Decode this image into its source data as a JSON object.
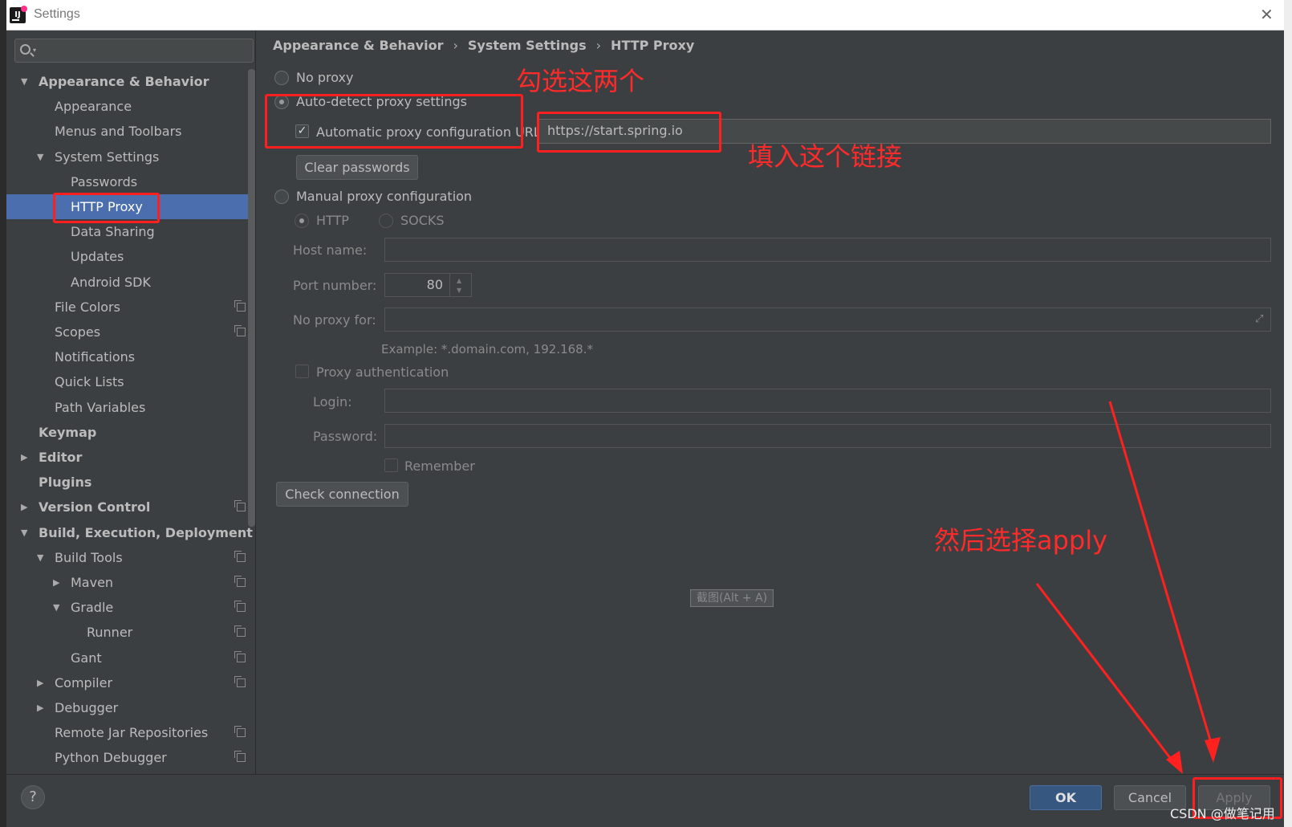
{
  "window": {
    "title": "Settings",
    "close_glyph": "✕"
  },
  "search": {
    "placeholder": ""
  },
  "tree": [
    {
      "label": "Appearance & Behavior",
      "level": 0,
      "arrow": "▼",
      "bold": true
    },
    {
      "label": "Appearance",
      "level": 1
    },
    {
      "label": "Menus and Toolbars",
      "level": 1
    },
    {
      "label": "System Settings",
      "level": 1,
      "arrow": "▼"
    },
    {
      "label": "Passwords",
      "level": 2
    },
    {
      "label": "HTTP Proxy",
      "level": 2,
      "selected": true
    },
    {
      "label": "Data Sharing",
      "level": 2
    },
    {
      "label": "Updates",
      "level": 2
    },
    {
      "label": "Android SDK",
      "level": 2
    },
    {
      "label": "File Colors",
      "level": 1,
      "copy": true
    },
    {
      "label": "Scopes",
      "level": 1,
      "copy": true
    },
    {
      "label": "Notifications",
      "level": 1
    },
    {
      "label": "Quick Lists",
      "level": 1
    },
    {
      "label": "Path Variables",
      "level": 1
    },
    {
      "label": "Keymap",
      "level": 0,
      "bold": true
    },
    {
      "label": "Editor",
      "level": 0,
      "arrow": "▶",
      "bold": true
    },
    {
      "label": "Plugins",
      "level": 0,
      "bold": true
    },
    {
      "label": "Version Control",
      "level": 0,
      "arrow": "▶",
      "bold": true,
      "copy": true
    },
    {
      "label": "Build, Execution, Deployment",
      "level": 0,
      "arrow": "▼",
      "bold": true
    },
    {
      "label": "Build Tools",
      "level": 1,
      "arrow": "▼",
      "copy": true
    },
    {
      "label": "Maven",
      "level": 2,
      "arrow": "▶",
      "copy": true
    },
    {
      "label": "Gradle",
      "level": 2,
      "arrow": "▼",
      "copy": true
    },
    {
      "label": "Runner",
      "level": 3,
      "copy": true
    },
    {
      "label": "Gant",
      "level": 2,
      "copy": true
    },
    {
      "label": "Compiler",
      "level": 1,
      "arrow": "▶",
      "copy": true
    },
    {
      "label": "Debugger",
      "level": 1,
      "arrow": "▶"
    },
    {
      "label": "Remote Jar Repositories",
      "level": 1,
      "copy": true
    },
    {
      "label": "Python Debugger",
      "level": 1,
      "copy": true
    }
  ],
  "breadcrumb": {
    "items": [
      "Appearance & Behavior",
      "System Settings",
      "HTTP Proxy"
    ],
    "separator": "›"
  },
  "proxy": {
    "no_proxy": "No proxy",
    "auto_detect": "Auto-detect proxy settings",
    "auto_config_url_label": "Automatic proxy configuration URL:",
    "auto_config_url_value": "https://start.spring.io",
    "clear_passwords": "Clear passwords",
    "manual": "Manual proxy configuration",
    "http": "HTTP",
    "socks": "SOCKS",
    "host_label": "Host name:",
    "port_label": "Port number:",
    "port_value": "80",
    "no_proxy_for_label": "No proxy for:",
    "example": "Example: *.domain.com, 192.168.*",
    "proxy_auth": "Proxy authentication",
    "login_label": "Login:",
    "password_label": "Password:",
    "remember": "Remember",
    "check_connection": "Check connection"
  },
  "tooltip": "截图(Alt + A)",
  "buttons": {
    "ok": "OK",
    "cancel": "Cancel",
    "apply": "Apply",
    "help": "?"
  },
  "annotations": {
    "check_these_two": "勾选这两个",
    "fill_this_link": "填入这个链接",
    "then_select_apply": "然后选择apply"
  },
  "watermark": "CSDN @做笔记用",
  "colors": {
    "selection": "#4b6eaf",
    "annotation_red": "#ff2a2a",
    "ok_button": "#365880"
  }
}
